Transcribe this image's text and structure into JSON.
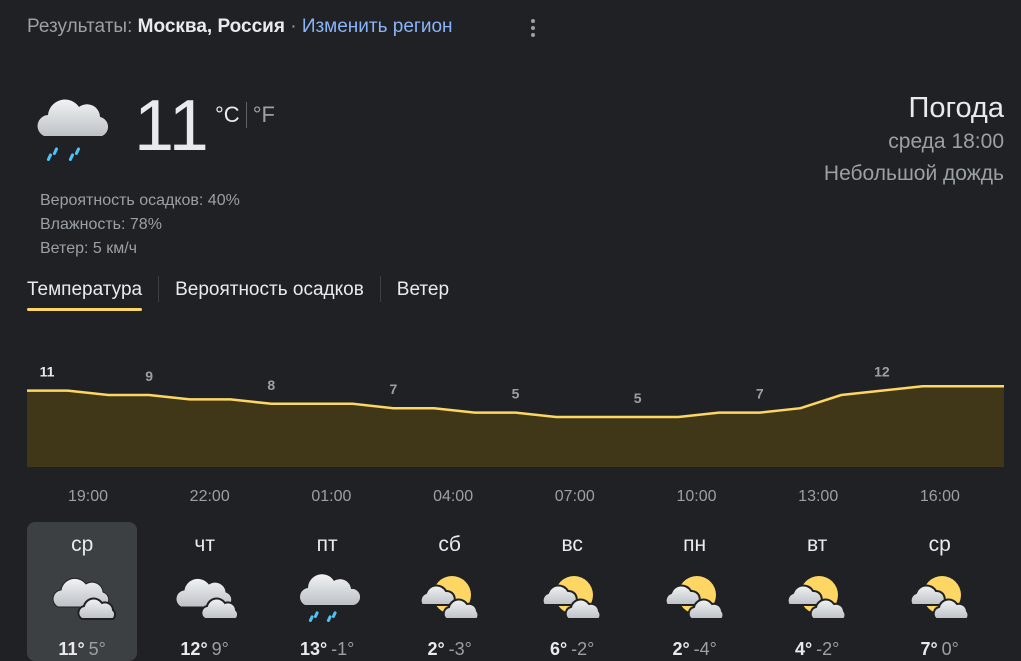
{
  "header": {
    "prefix": "Результаты:",
    "location": "Москва, Россия",
    "separator": "·",
    "change_region": "Изменить регион"
  },
  "current": {
    "temp": "11",
    "unit_c": "°C",
    "unit_f": "°F",
    "icon": "rain-cloud-icon",
    "precip": "Вероятность осадков: 40%",
    "humidity": "Влажность: 78%",
    "wind": "Ветер: 5 км/ч",
    "title": "Погода",
    "datetime": "среда 18:00",
    "condition": "Небольшой дождь"
  },
  "tabs": [
    "Температура",
    "Вероятность осадков",
    "Ветер"
  ],
  "colors": {
    "line": "#fdd663",
    "fill": "#3f3718",
    "label_first": "#e8eaed",
    "label": "#9aa0a6"
  },
  "chart_data": {
    "type": "area",
    "x": [
      "18:00",
      "19:00",
      "20:00",
      "21:00",
      "22:00",
      "23:00",
      "00:00",
      "01:00",
      "02:00",
      "03:00",
      "04:00",
      "05:00",
      "06:00",
      "07:00",
      "08:00",
      "09:00",
      "10:00",
      "11:00",
      "12:00",
      "13:00",
      "14:00",
      "15:00",
      "16:00",
      "17:00",
      "18:00"
    ],
    "values": [
      11,
      11,
      10,
      10,
      9,
      9,
      8,
      8,
      8,
      7,
      7,
      6,
      6,
      5,
      5,
      5,
      5,
      6,
      6,
      7,
      10,
      11,
      12,
      12,
      12
    ],
    "labels": [
      {
        "index": 0,
        "text": "11"
      },
      {
        "index": 3,
        "text": "9"
      },
      {
        "index": 6,
        "text": "8"
      },
      {
        "index": 9,
        "text": "7"
      },
      {
        "index": 12,
        "text": "5"
      },
      {
        "index": 15,
        "text": "5"
      },
      {
        "index": 18,
        "text": "7"
      },
      {
        "index": 21,
        "text": "12"
      }
    ],
    "x_ticks": [
      "19:00",
      "22:00",
      "01:00",
      "04:00",
      "07:00",
      "10:00",
      "13:00",
      "16:00"
    ]
  },
  "days": [
    {
      "name": "ср",
      "icon": "partly-cloudy-icon",
      "hi": "11°",
      "lo": "5°",
      "selected": true
    },
    {
      "name": "чт",
      "icon": "partly-cloudy-icon",
      "hi": "12°",
      "lo": "9°"
    },
    {
      "name": "пт",
      "icon": "rain-cloud-icon",
      "hi": "13°",
      "lo": "-1°"
    },
    {
      "name": "сб",
      "icon": "sun-cloud-icon",
      "hi": "2°",
      "lo": "-3°"
    },
    {
      "name": "вс",
      "icon": "sun-cloud-icon",
      "hi": "6°",
      "lo": "-2°"
    },
    {
      "name": "пн",
      "icon": "sun-cloud-icon",
      "hi": "2°",
      "lo": "-4°"
    },
    {
      "name": "вт",
      "icon": "sun-cloud-icon",
      "hi": "4°",
      "lo": "-2°"
    },
    {
      "name": "ср",
      "icon": "sun-cloud-icon",
      "hi": "7°",
      "lo": "0°"
    }
  ]
}
